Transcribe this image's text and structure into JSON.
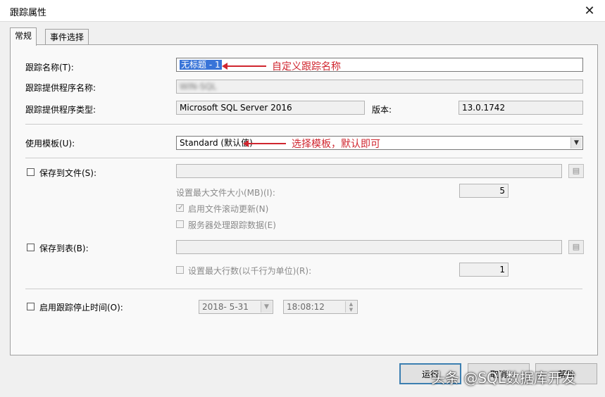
{
  "window": {
    "title": "跟踪属性"
  },
  "tabs": [
    {
      "label": "常规"
    },
    {
      "label": "事件选择"
    }
  ],
  "general": {
    "trace_name_label": "跟踪名称(T):",
    "trace_name_value": "无标题 - 1",
    "provider_name_label": "跟踪提供程序名称:",
    "provider_name_value": "WIN-SQL",
    "provider_type_label": "跟踪提供程序类型:",
    "provider_type_value": "Microsoft SQL Server 2016",
    "version_label": "版本:",
    "version_value": "13.0.1742",
    "template_label": "使用模板(U):",
    "template_value": "Standard (默认值)",
    "save_file_label": "保存到文件(S):",
    "max_file_size_label": "设置最大文件大小(MB)(I):",
    "max_file_size_value": "5",
    "file_rollover_label": "启用文件滚动更新(N)",
    "server_process_label": "服务器处理跟踪数据(E)",
    "save_table_label": "保存到表(B):",
    "max_rows_label": "设置最大行数(以千行为单位)(R):",
    "max_rows_value": "1",
    "stop_time_label": "启用跟踪停止时间(O):",
    "stop_date_value": "2018- 5-31",
    "stop_time_value": "18:08:12"
  },
  "annotations": {
    "name_note": "自定义跟踪名称",
    "template_note": "选择模板，默认即可",
    "color": "#d0262f"
  },
  "buttons": {
    "run": "运行",
    "cancel": "取消",
    "help": "帮助"
  },
  "watermark": "头条 @SQL数据库开发",
  "icons": {
    "close": "close-icon",
    "browse": "folder-browse-icon"
  }
}
